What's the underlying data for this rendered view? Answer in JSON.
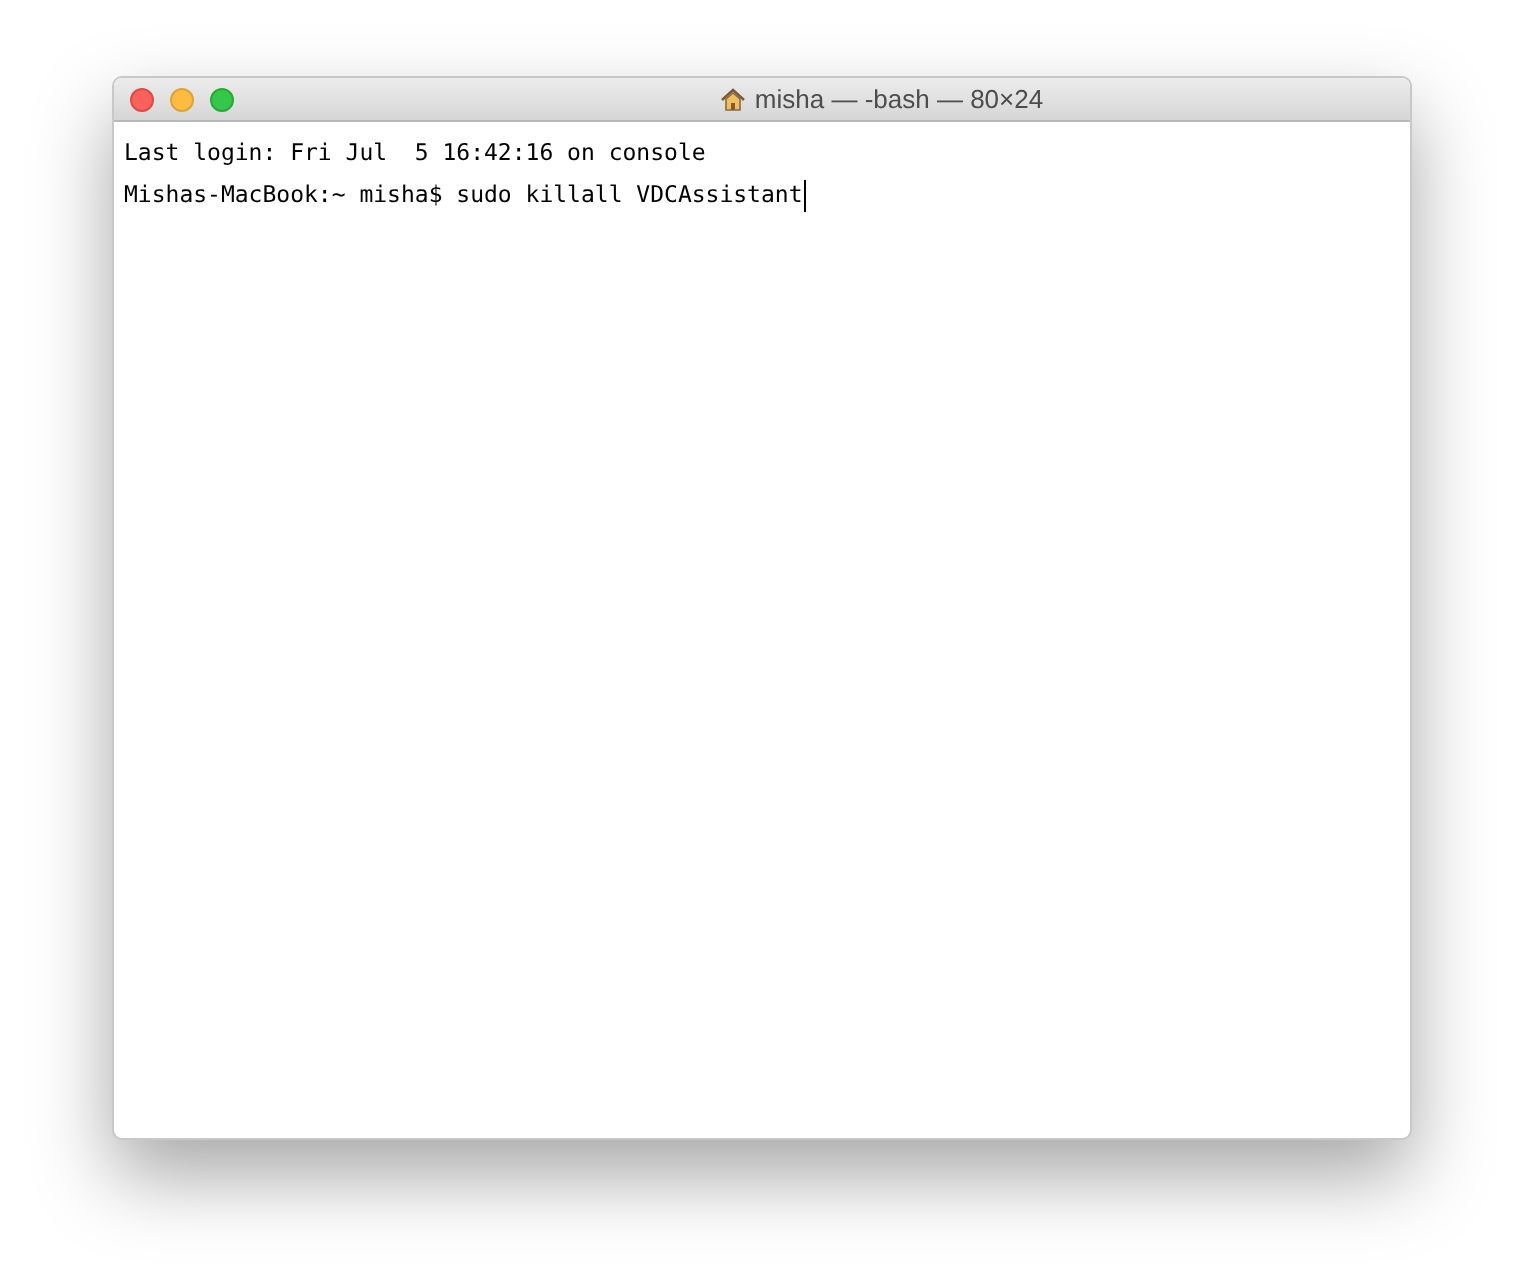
{
  "window": {
    "title": "misha — -bash — 80×24"
  },
  "terminal": {
    "lines": [
      "Last login: Fri Jul  5 16:42:16 on console",
      "Mishas-MacBook:~ misha$ sudo killall VDCAssistant"
    ],
    "cursor": true
  }
}
